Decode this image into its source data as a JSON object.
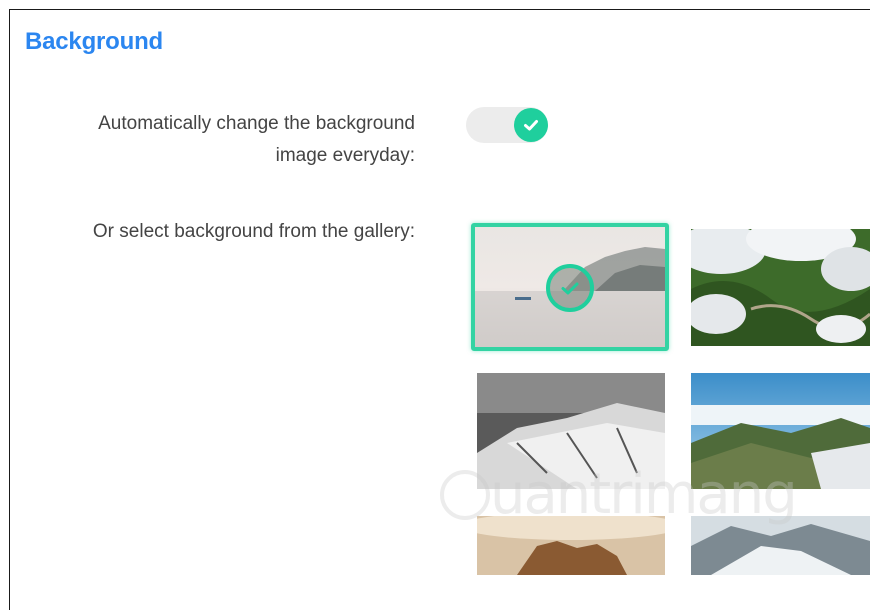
{
  "section": {
    "title": "Background"
  },
  "auto_change": {
    "label_line1": "Automatically change the background",
    "label_line2": "image everyday:",
    "enabled": true
  },
  "gallery": {
    "label": "Or select background from the gallery:",
    "selected_index": 0,
    "items": [
      {
        "description_icon": "misty-lake-thumbnail",
        "selected": true
      },
      {
        "description_icon": "forest-clouds-thumbnail",
        "selected": false
      },
      {
        "description_icon": "snowy-mountain-bw-thumbnail",
        "selected": false
      },
      {
        "description_icon": "alpine-valley-thumbnail",
        "selected": false
      },
      {
        "description_icon": "rock-formation-sunset-thumbnail",
        "selected": false
      },
      {
        "description_icon": "glacier-thumbnail",
        "selected": false
      }
    ]
  },
  "watermark": {
    "text": "uantrimang"
  },
  "colors": {
    "accent": "#1fcf9d",
    "title": "#2b86f0"
  }
}
